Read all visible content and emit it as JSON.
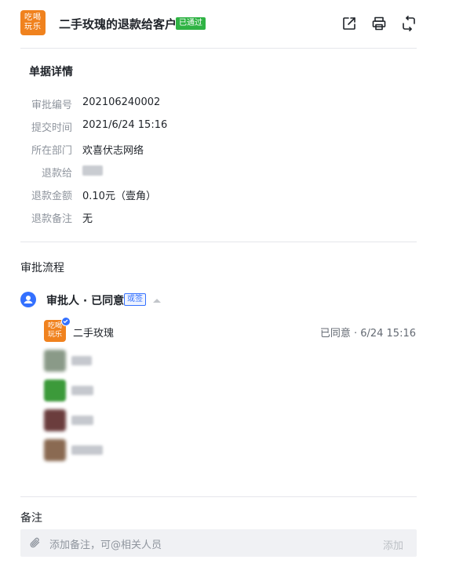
{
  "header": {
    "logo_text_top": "吃喝",
    "logo_text_bottom": "玩乐",
    "title": "二手玫瑰的退款给客户",
    "status_badge": "已通过"
  },
  "details": {
    "section_title": "单据详情",
    "fields": [
      {
        "label": "审批编号",
        "value": "202106240002"
      },
      {
        "label": "提交时间",
        "value": "2021/6/24 15:16"
      },
      {
        "label": "所在部门",
        "value": "欢喜伏志网络"
      },
      {
        "label": "退款给",
        "value": ""
      },
      {
        "label": "退款金额",
        "value": "0.10元（壹角）"
      },
      {
        "label": "退款备注",
        "value": "无"
      }
    ]
  },
  "flow": {
    "section_title": "审批流程",
    "node_title": "审批人 · 已同意",
    "node_tag": "或签",
    "approvers": [
      {
        "name": "二手玫瑰",
        "status": "已同意 · 6/24 15:16"
      }
    ]
  },
  "remark": {
    "section_title": "备注",
    "placeholder": "添加备注，可@相关人员",
    "add_label": "添加"
  },
  "colors": {
    "brand_orange": "#f0821e",
    "approved_green": "#2fb344",
    "accent_blue": "#3370ff"
  },
  "icons": [
    "share-icon",
    "print-icon",
    "transfer-icon",
    "user-icon",
    "caret-up-icon",
    "verified-check-icon",
    "paperclip-icon"
  ]
}
